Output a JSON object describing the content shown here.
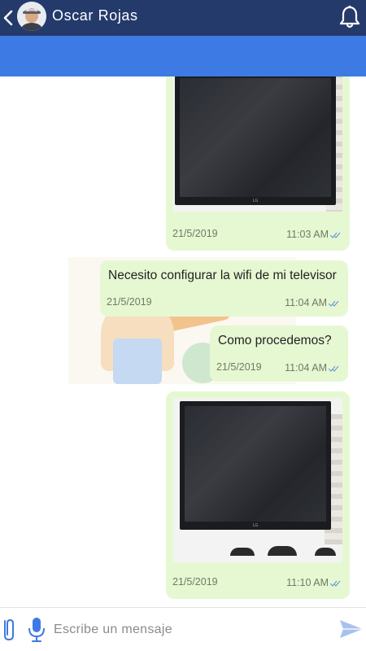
{
  "header": {
    "contact_name": "Oscar Rojas",
    "icons": {
      "back": "chevron-left-icon",
      "avatar": "avatar",
      "notifications": "bell-icon"
    }
  },
  "messages": [
    {
      "type": "image",
      "content": "tv-photo",
      "date": "21/5/2019",
      "time": "11:03 AM",
      "status": "read"
    },
    {
      "type": "text",
      "text": "Necesito configurar la wifi de mi televisor",
      "date": "21/5/2019",
      "time": "11:04 AM",
      "status": "read"
    },
    {
      "type": "text",
      "text": "Como procedemos?",
      "date": "21/5/2019",
      "time": "11:04 AM",
      "status": "read"
    },
    {
      "type": "image",
      "content": "tv-photo",
      "date": "21/5/2019",
      "time": "11:10 AM",
      "status": "read"
    }
  ],
  "composer": {
    "placeholder": "Escribe un mensaje",
    "value": "",
    "icons": {
      "attach": "paperclip-icon",
      "voice": "microphone-icon",
      "send": "send-icon"
    }
  },
  "colors": {
    "header_bg": "#243a6b",
    "subbar_bg": "#3d7ae4",
    "bubble_bg": "#e6f8d2",
    "tick_color": "#6b9bd1",
    "accent": "#3d7ae4"
  }
}
